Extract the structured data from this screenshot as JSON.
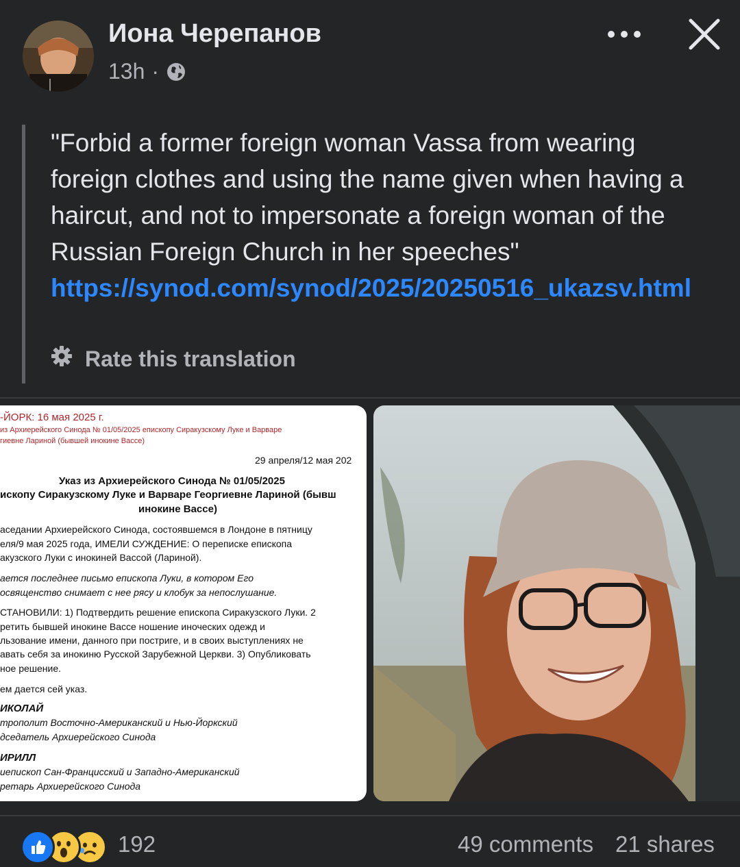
{
  "post": {
    "author": "Иона Черепанов",
    "time": "13h",
    "separator": "·",
    "privacy_icon": "globe-icon"
  },
  "content": {
    "text": "\"Forbid a former foreign woman Vassa from wearing foreign clothes and using the name given when having a haircut, and not to impersonate a foreign woman of the Russian Foreign Church in her speeches\"",
    "link": "https://synod.com/synod/2025/20250516_ukazsv.html",
    "rate_label": "Rate this translation"
  },
  "document": {
    "header1": "-ЙОРК: 16 мая 2025 г.",
    "header2": "из Архиерейского Синода № 01/05/2025 епископу Сиракузскому Луке и Варваре",
    "header3": "гиевне Лариной (бывшей инокине Вассе)",
    "date": "29 апреля/12 мая 202",
    "title1": "Указ из Архиерейского Синода № 01/05/2025",
    "title2": "ископу Сиракузскому Луке и Варваре Георгиевне Лариной (бывш",
    "title3": "инокине Вассе)",
    "p1a": "аседании Архиерейского Синода, состоявшемся в Лондоне в пятницу",
    "p1b": "еля/9 мая 2025 года, ИМЕЛИ СУЖДЕНИЕ: О переписке епископа",
    "p1c": "акузского Луки с инокиней Вассой (Лариной).",
    "p2a": "ается последнее письмо епископа Луки, в котором Его",
    "p2b": "освященство снимает с нее рясу и клобук за непослушание.",
    "p3a": "СТАНОВИЛИ: 1) Подтвердить решение епископа Сиракузского Луки. 2",
    "p3b": "ретить бывшей инокине Вассе ношение иноческих одежд и",
    "p3c": "льзование имени, данного при постриге, и в своих выступлениях не",
    "p3d": "авать себя за инокиню Русской Зарубежной Церкви. 3) Опубликовать",
    "p3e": "ное решение.",
    "p4": "ем дается сей указ.",
    "sig1": "ИКОЛАЙ",
    "sig1a": "трополит Восточно-Американский и Нью-Йоркский",
    "sig1b": "дседатель Архиерейского Синода",
    "sig2": "ИРИЛЛ",
    "sig2a": "иепископ Сан-Францисский и Западно-Американский",
    "sig2b": "ретарь Архиерейского Синода"
  },
  "footer": {
    "reaction_count": "192",
    "comments": "49 comments",
    "shares": "21 shares",
    "reactions": [
      "like-icon",
      "wow-icon",
      "sad-icon"
    ]
  },
  "colors": {
    "background": "#242526",
    "link": "#2d88ff",
    "secondary_text": "#b0b3b8",
    "like_blue": "#1877f2",
    "doc_red": "#b0262b"
  }
}
